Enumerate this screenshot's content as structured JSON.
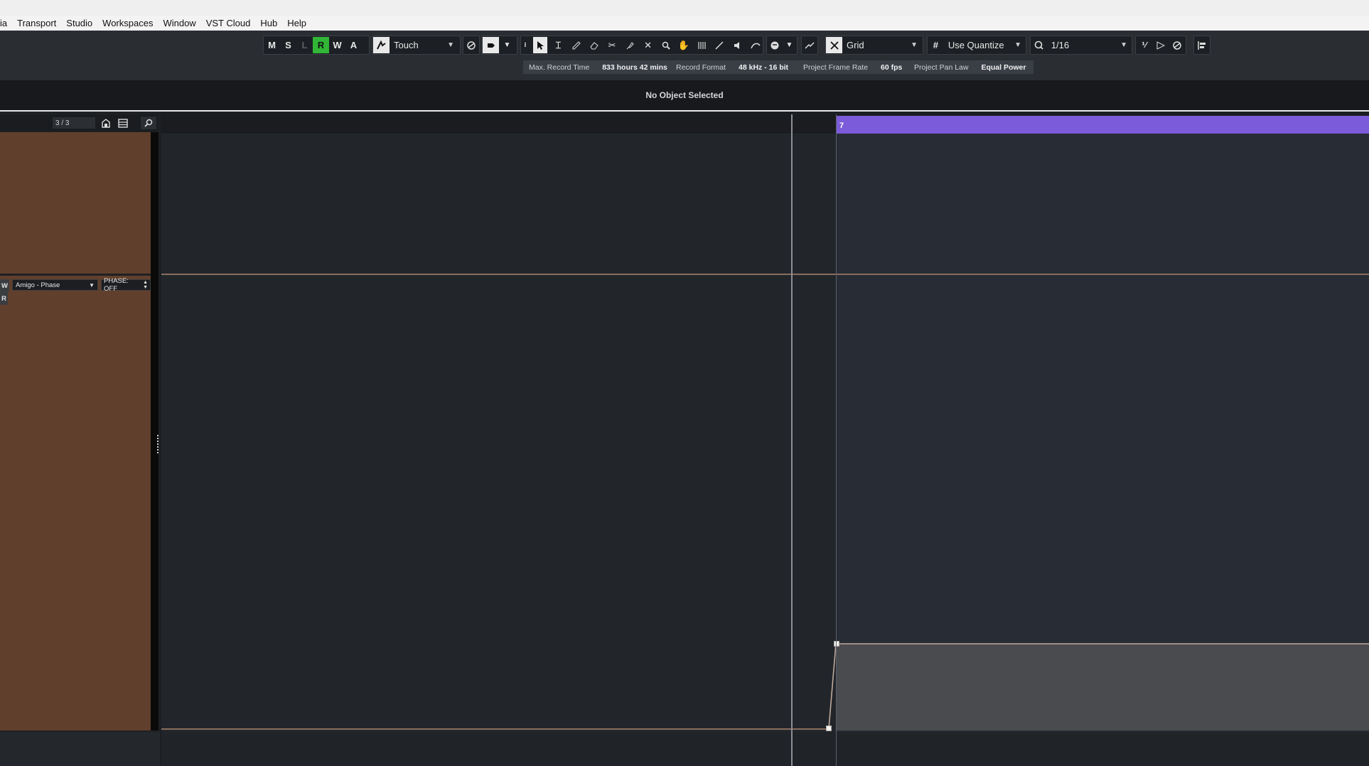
{
  "menu": [
    "ia",
    "Transport",
    "Studio",
    "Workspaces",
    "Window",
    "VST Cloud",
    "Hub",
    "Help"
  ],
  "toolbar": {
    "state_buttons": [
      "M",
      "S",
      "L",
      "R",
      "W",
      "A"
    ],
    "automation_mode": "Touch",
    "snap_type": "Grid",
    "grid_quantize": "Use Quantize",
    "quantize_value": "1/16"
  },
  "info_line": [
    {
      "label": "Max. Record Time",
      "value": "833 hours 42 mins"
    },
    {
      "label": "Record Format",
      "value": "48 kHz - 16 bit"
    },
    {
      "label": "Project Frame Rate",
      "value": "60 fps"
    },
    {
      "label": "Project Pan Law",
      "value": "Equal Power"
    }
  ],
  "status": "No Object Selected",
  "track_list": {
    "counter": "3 / 3",
    "automation_parameter": "Amigo - Phase",
    "automation_value": "PHASE: OFF",
    "btn_w": "W",
    "btn_r": "R"
  },
  "ruler": {
    "bar_label": "7"
  },
  "colors": {
    "track": "#613f2d",
    "locator_region": "#7b5bd9",
    "read_green": "#31b637"
  }
}
